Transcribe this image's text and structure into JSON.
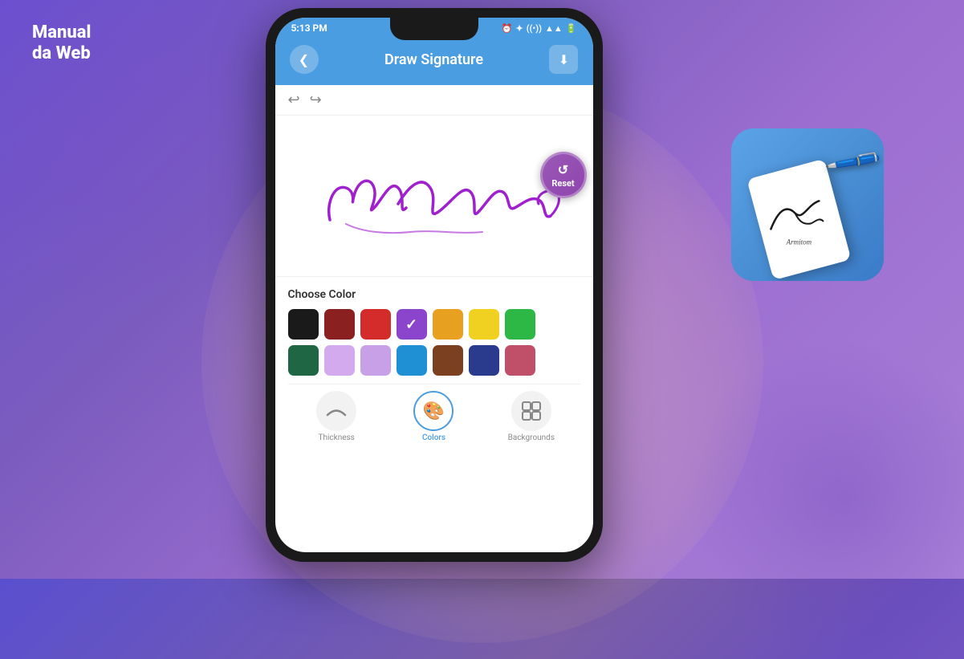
{
  "logo": {
    "line1": "Manual",
    "line2": "da Web"
  },
  "status_bar": {
    "time": "5:13 PM",
    "icons": "⏰ ✿ ⊕ ▲ 🔋"
  },
  "header": {
    "title": "Draw Signature",
    "back_label": "‹",
    "download_label": "⬇"
  },
  "reset_button": {
    "label": "Reset"
  },
  "toolbar": {
    "undo": "↩",
    "redo": "↪"
  },
  "color_panel": {
    "title": "Choose Color",
    "colors_row1": [
      {
        "hex": "#1a1a1a",
        "selected": false
      },
      {
        "hex": "#8b2020",
        "selected": false
      },
      {
        "hex": "#d42b2b",
        "selected": false
      },
      {
        "hex": "#8b44cc",
        "selected": true
      },
      {
        "hex": "#e8a020",
        "selected": false
      },
      {
        "hex": "#f0d020",
        "selected": false
      },
      {
        "hex": "#2db845",
        "selected": false
      }
    ],
    "colors_row2": [
      {
        "hex": "#1e6644",
        "selected": false
      },
      {
        "hex": "#d4aaee",
        "selected": false
      },
      {
        "hex": "#c8a0e8",
        "selected": false
      },
      {
        "hex": "#2090d4",
        "selected": false
      },
      {
        "hex": "#7a4020",
        "selected": false
      },
      {
        "hex": "#2a3a8c",
        "selected": false
      },
      {
        "hex": "#c0506a",
        "selected": false
      }
    ]
  },
  "bottom_tabs": [
    {
      "label": "Thickness",
      "icon": "〜",
      "active": false
    },
    {
      "label": "Colors",
      "icon": "🎨",
      "active": true
    },
    {
      "label": "Backgrounds",
      "icon": "⊞",
      "active": false
    }
  ]
}
